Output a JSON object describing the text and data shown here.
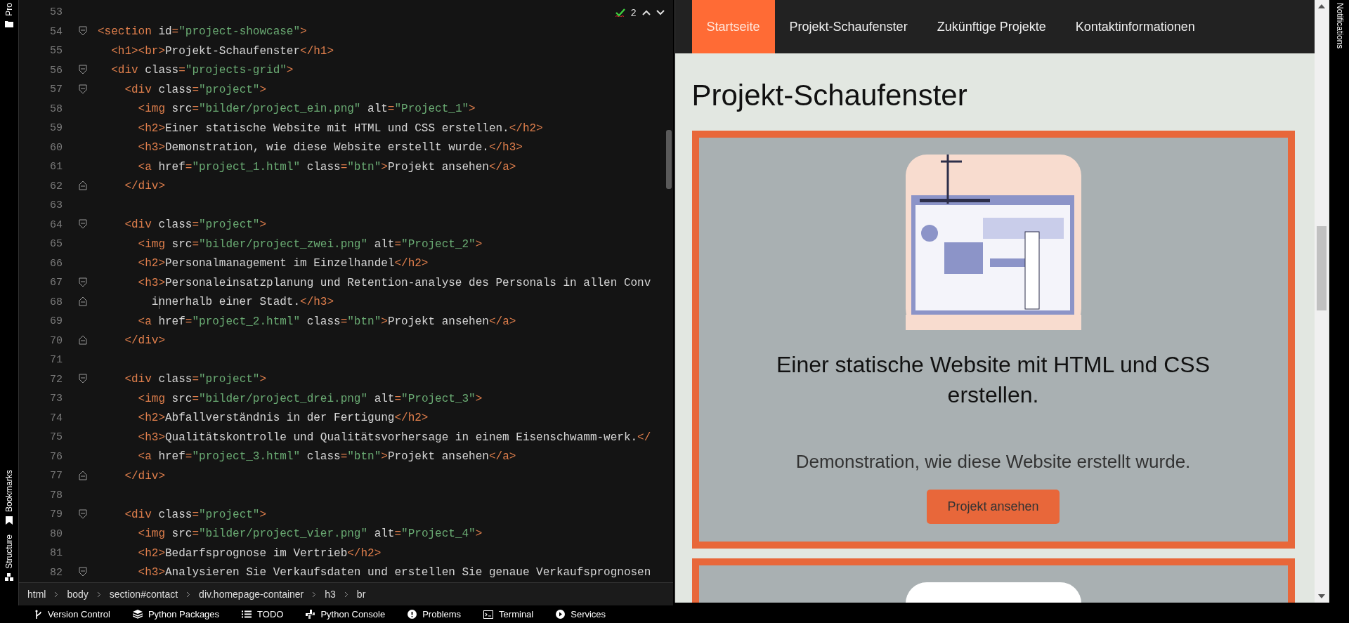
{
  "left_stripe": {
    "top_tab": "Pro",
    "bottom_tabs": [
      {
        "label": "Bookmarks",
        "kind": "bookmark"
      },
      {
        "label": "Structure",
        "kind": "structure"
      }
    ]
  },
  "editor": {
    "inspection_count": "2",
    "lines": [
      {
        "number": "53",
        "fold_start": false,
        "fold_end": false
      },
      {
        "number": "54",
        "fold_start": true,
        "fold_end": false,
        "tokens": [
          {
            "kind": "tag",
            "text": "<section"
          },
          {
            "kind": "attr",
            "text": " id"
          },
          {
            "kind": "tag",
            "text": "="
          },
          {
            "kind": "str",
            "text": "\"project-showcase\""
          },
          {
            "kind": "tag",
            "text": ">"
          }
        ]
      },
      {
        "number": "55",
        "fold_start": false,
        "fold_end": false,
        "tokens": [
          {
            "kind": "tag",
            "text": "  <h1><br>"
          },
          {
            "kind": "text",
            "text": "Projekt-Schaufenster"
          },
          {
            "kind": "tag",
            "text": "</h1>"
          }
        ]
      },
      {
        "number": "56",
        "fold_start": true,
        "fold_end": false,
        "tokens": [
          {
            "kind": "tag",
            "text": "  <div"
          },
          {
            "kind": "attr",
            "text": " class"
          },
          {
            "kind": "tag",
            "text": "="
          },
          {
            "kind": "str",
            "text": "\"projects-grid\""
          },
          {
            "kind": "tag",
            "text": ">"
          }
        ]
      },
      {
        "number": "57",
        "fold_start": true,
        "fold_end": false,
        "tokens": [
          {
            "kind": "tag",
            "text": "    <div"
          },
          {
            "kind": "attr",
            "text": " class"
          },
          {
            "kind": "tag",
            "text": "="
          },
          {
            "kind": "str",
            "text": "\"project\""
          },
          {
            "kind": "tag",
            "text": ">"
          }
        ]
      },
      {
        "number": "58",
        "fold_start": false,
        "fold_end": false,
        "tokens": [
          {
            "kind": "tag",
            "text": "      <img"
          },
          {
            "kind": "attr",
            "text": " src"
          },
          {
            "kind": "tag",
            "text": "="
          },
          {
            "kind": "str",
            "text": "\"bilder/project_ein.png\""
          },
          {
            "kind": "attr",
            "text": " alt"
          },
          {
            "kind": "tag",
            "text": "="
          },
          {
            "kind": "str",
            "text": "\"Project_1\""
          },
          {
            "kind": "tag",
            "text": ">"
          }
        ]
      },
      {
        "number": "59",
        "fold_start": false,
        "fold_end": false,
        "tokens": [
          {
            "kind": "tag",
            "text": "      <h2>"
          },
          {
            "kind": "text",
            "text": "Einer statische Website mit HTML und CSS erstellen."
          },
          {
            "kind": "tag",
            "text": "</h2>"
          }
        ]
      },
      {
        "number": "60",
        "fold_start": false,
        "fold_end": false,
        "tokens": [
          {
            "kind": "tag",
            "text": "      <h3>"
          },
          {
            "kind": "text",
            "text": "Demonstration, wie diese Website erstellt wurde."
          },
          {
            "kind": "tag",
            "text": "</h3>"
          }
        ]
      },
      {
        "number": "61",
        "fold_start": false,
        "fold_end": false,
        "tokens": [
          {
            "kind": "tag",
            "text": "      <a"
          },
          {
            "kind": "attr",
            "text": " href"
          },
          {
            "kind": "tag",
            "text": "="
          },
          {
            "kind": "str",
            "text": "\"project_1.html\""
          },
          {
            "kind": "attr",
            "text": " class"
          },
          {
            "kind": "tag",
            "text": "="
          },
          {
            "kind": "str",
            "text": "\"btn\""
          },
          {
            "kind": "tag",
            "text": ">"
          },
          {
            "kind": "text",
            "text": "Projekt ansehen"
          },
          {
            "kind": "tag",
            "text": "</a>"
          }
        ]
      },
      {
        "number": "62",
        "fold_start": false,
        "fold_end": true,
        "tokens": [
          {
            "kind": "tag",
            "text": "    </div>"
          }
        ]
      },
      {
        "number": "63",
        "fold_start": false,
        "fold_end": false
      },
      {
        "number": "64",
        "fold_start": true,
        "fold_end": false,
        "tokens": [
          {
            "kind": "tag",
            "text": "    <div"
          },
          {
            "kind": "attr",
            "text": " class"
          },
          {
            "kind": "tag",
            "text": "="
          },
          {
            "kind": "str",
            "text": "\"project\""
          },
          {
            "kind": "tag",
            "text": ">"
          }
        ]
      },
      {
        "number": "65",
        "fold_start": false,
        "fold_end": false,
        "tokens": [
          {
            "kind": "tag",
            "text": "      <img"
          },
          {
            "kind": "attr",
            "text": " src"
          },
          {
            "kind": "tag",
            "text": "="
          },
          {
            "kind": "str",
            "text": "\"bilder/project_zwei.png\""
          },
          {
            "kind": "attr",
            "text": " alt"
          },
          {
            "kind": "tag",
            "text": "="
          },
          {
            "kind": "str",
            "text": "\"Project_2\""
          },
          {
            "kind": "tag",
            "text": ">"
          }
        ]
      },
      {
        "number": "66",
        "fold_start": false,
        "fold_end": false,
        "tokens": [
          {
            "kind": "tag",
            "text": "      <h2>"
          },
          {
            "kind": "text",
            "text": "Personalmanagement im Einzelhandel"
          },
          {
            "kind": "tag",
            "text": "</h2>"
          }
        ]
      },
      {
        "number": "67",
        "fold_start": true,
        "fold_end": false,
        "tokens": [
          {
            "kind": "tag",
            "text": "      <h3>"
          },
          {
            "kind": "text",
            "text": "Personaleinsatzplanung und Retention-analyse des Personals in allen Conv"
          }
        ]
      },
      {
        "number": "68",
        "fold_start": false,
        "fold_end": true,
        "wrapped": true,
        "tokens": [
          {
            "kind": "text",
            "text": "        innerhalb einer Stadt."
          },
          {
            "kind": "tag",
            "text": "</h3>"
          }
        ]
      },
      {
        "number": "69",
        "fold_start": false,
        "fold_end": false,
        "tokens": [
          {
            "kind": "tag",
            "text": "      <a"
          },
          {
            "kind": "attr",
            "text": " href"
          },
          {
            "kind": "tag",
            "text": "="
          },
          {
            "kind": "str",
            "text": "\"project_2.html\""
          },
          {
            "kind": "attr",
            "text": " class"
          },
          {
            "kind": "tag",
            "text": "="
          },
          {
            "kind": "str",
            "text": "\"btn\""
          },
          {
            "kind": "tag",
            "text": ">"
          },
          {
            "kind": "text",
            "text": "Projekt ansehen"
          },
          {
            "kind": "tag",
            "text": "</a>"
          }
        ]
      },
      {
        "number": "70",
        "fold_start": false,
        "fold_end": true,
        "tokens": [
          {
            "kind": "tag",
            "text": "    </div>"
          }
        ]
      },
      {
        "number": "71",
        "fold_start": false,
        "fold_end": false
      },
      {
        "number": "72",
        "fold_start": true,
        "fold_end": false,
        "tokens": [
          {
            "kind": "tag",
            "text": "    <div"
          },
          {
            "kind": "attr",
            "text": " class"
          },
          {
            "kind": "tag",
            "text": "="
          },
          {
            "kind": "str",
            "text": "\"project\""
          },
          {
            "kind": "tag",
            "text": ">"
          }
        ]
      },
      {
        "number": "73",
        "fold_start": false,
        "fold_end": false,
        "tokens": [
          {
            "kind": "tag",
            "text": "      <img"
          },
          {
            "kind": "attr",
            "text": " src"
          },
          {
            "kind": "tag",
            "text": "="
          },
          {
            "kind": "str",
            "text": "\"bilder/project_drei.png\""
          },
          {
            "kind": "attr",
            "text": " alt"
          },
          {
            "kind": "tag",
            "text": "="
          },
          {
            "kind": "str",
            "text": "\"Project_3\""
          },
          {
            "kind": "tag",
            "text": ">"
          }
        ]
      },
      {
        "number": "74",
        "fold_start": false,
        "fold_end": false,
        "tokens": [
          {
            "kind": "tag",
            "text": "      <h2>"
          },
          {
            "kind": "text",
            "text": "Abfallverständnis in der Fertigung"
          },
          {
            "kind": "tag",
            "text": "</h2>"
          }
        ]
      },
      {
        "number": "75",
        "fold_start": false,
        "fold_end": false,
        "tokens": [
          {
            "kind": "tag",
            "text": "      <h3>"
          },
          {
            "kind": "text",
            "text": "Qualitätskontrolle und Qualitätsvorhersage in einem Eisenschwamm-werk."
          },
          {
            "kind": "tag",
            "text": "</"
          }
        ]
      },
      {
        "number": "76",
        "fold_start": false,
        "fold_end": false,
        "tokens": [
          {
            "kind": "tag",
            "text": "      <a"
          },
          {
            "kind": "attr",
            "text": " href"
          },
          {
            "kind": "tag",
            "text": "="
          },
          {
            "kind": "str",
            "text": "\"project_3.html\""
          },
          {
            "kind": "attr",
            "text": " class"
          },
          {
            "kind": "tag",
            "text": "="
          },
          {
            "kind": "str",
            "text": "\"btn\""
          },
          {
            "kind": "tag",
            "text": ">"
          },
          {
            "kind": "text",
            "text": "Projekt ansehen"
          },
          {
            "kind": "tag",
            "text": "</a>"
          }
        ]
      },
      {
        "number": "77",
        "fold_start": false,
        "fold_end": true,
        "tokens": [
          {
            "kind": "tag",
            "text": "    </div>"
          }
        ]
      },
      {
        "number": "78",
        "fold_start": false,
        "fold_end": false
      },
      {
        "number": "79",
        "fold_start": true,
        "fold_end": false,
        "tokens": [
          {
            "kind": "tag",
            "text": "    <div"
          },
          {
            "kind": "attr",
            "text": " class"
          },
          {
            "kind": "tag",
            "text": "="
          },
          {
            "kind": "str",
            "text": "\"project\""
          },
          {
            "kind": "tag",
            "text": ">"
          }
        ]
      },
      {
        "number": "80",
        "fold_start": false,
        "fold_end": false,
        "tokens": [
          {
            "kind": "tag",
            "text": "      <img"
          },
          {
            "kind": "attr",
            "text": " src"
          },
          {
            "kind": "tag",
            "text": "="
          },
          {
            "kind": "str",
            "text": "\"bilder/project_vier.png\""
          },
          {
            "kind": "attr",
            "text": " alt"
          },
          {
            "kind": "tag",
            "text": "="
          },
          {
            "kind": "str",
            "text": "\"Project_4\""
          },
          {
            "kind": "tag",
            "text": ">"
          }
        ]
      },
      {
        "number": "81",
        "fold_start": false,
        "fold_end": false,
        "tokens": [
          {
            "kind": "tag",
            "text": "      <h2>"
          },
          {
            "kind": "text",
            "text": "Bedarfsprognose im Vertrieb"
          },
          {
            "kind": "tag",
            "text": "</h2>"
          }
        ]
      },
      {
        "number": "82",
        "fold_start": true,
        "fold_end": false,
        "tokens": [
          {
            "kind": "tag",
            "text": "      <h3>"
          },
          {
            "kind": "text",
            "text": "Analysieren Sie Verkaufsdaten und erstellen Sie genaue Verkaufsprognosen"
          }
        ]
      }
    ]
  },
  "breadcrumb": [
    "html",
    "body",
    "section#contact",
    "div.homepage-container",
    "h3",
    "br"
  ],
  "preview": {
    "nav": [
      {
        "label": "Startseite",
        "selected": true
      },
      {
        "label": "Projekt-Schaufenster",
        "selected": false
      },
      {
        "label": "Zukünftige Projekte",
        "selected": false
      },
      {
        "label": "Kontaktinformationen",
        "selected": false
      }
    ],
    "heading": "Projekt-Schaufenster",
    "project": {
      "title": "Einer statische Website mit HTML und CSS erstellen.",
      "subtitle": "Demonstration, wie diese Website erstellt wurde.",
      "button": "Projekt ansehen"
    }
  },
  "right_stripe": {
    "label": "Notifications"
  },
  "tool_windows": [
    {
      "label": "Version Control",
      "kind": "vcs"
    },
    {
      "label": "Python Packages",
      "kind": "packages"
    },
    {
      "label": "TODO",
      "kind": "list"
    },
    {
      "label": "Python Console",
      "kind": "python"
    },
    {
      "label": "Problems",
      "kind": "problems"
    },
    {
      "label": "Terminal",
      "kind": "terminal"
    },
    {
      "label": "Services",
      "kind": "services"
    }
  ]
}
